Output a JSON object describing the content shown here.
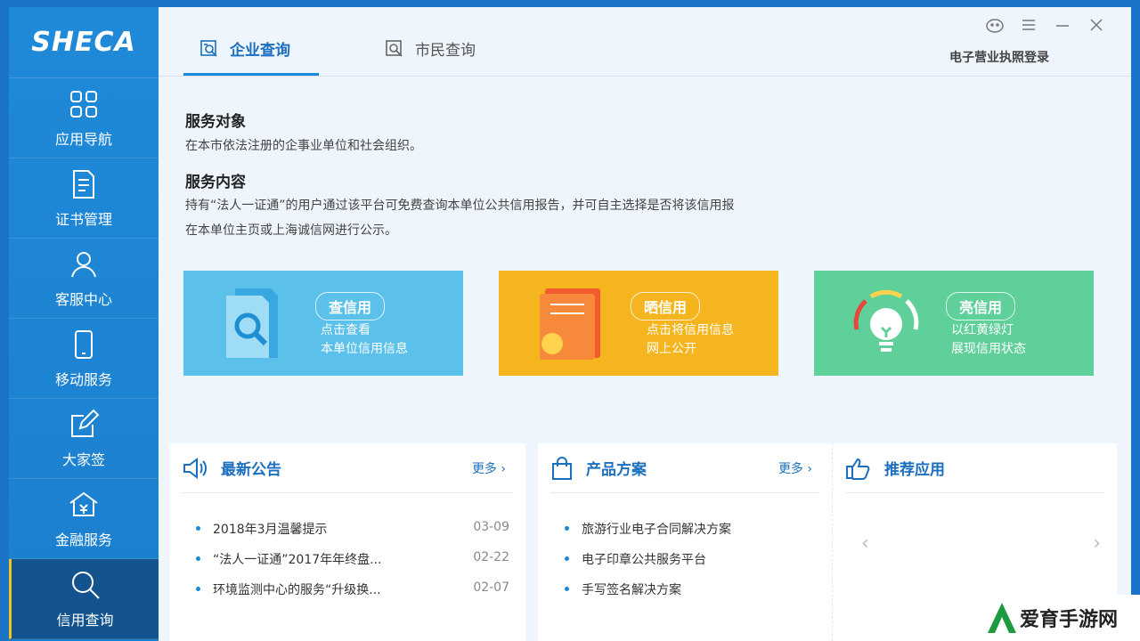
{
  "logo": {
    "text": "SHECA"
  },
  "sidebar": {
    "items": [
      {
        "label": "应用导航",
        "icon": "grid-icon"
      },
      {
        "label": "证书管理",
        "icon": "document-icon"
      },
      {
        "label": "客服中心",
        "icon": "user-icon"
      },
      {
        "label": "移动服务",
        "icon": "phone-icon"
      },
      {
        "label": "大家签",
        "icon": "edit-icon"
      },
      {
        "label": "金融服务",
        "icon": "bank-icon"
      },
      {
        "label": "信用查询",
        "icon": "search-icon",
        "active": true
      }
    ]
  },
  "tabs": [
    {
      "label": "企业查询",
      "active": true
    },
    {
      "label": "市民查询",
      "active": false
    }
  ],
  "header": {
    "biz_login": "电子营业执照登录"
  },
  "service": {
    "target_title": "服务对象",
    "target_text": "在本市依法注册的企事业单位和社会组织。",
    "content_title": "服务内容",
    "content_line1": "持有“法人一证通”的用户通过该平台可免费查询本单位公共信用报告，并可自主选择是否将该信用报",
    "content_line2": "在本单位主页或上海诚信网进行公示。"
  },
  "cards": [
    {
      "title": "查信用",
      "line1": "点击查看",
      "line2": "本单位信用信息",
      "color": "#5bc0ea"
    },
    {
      "title": "晒信用",
      "line1": "点击将信用信息",
      "line2": "网上公开",
      "color": "#f5b51f"
    },
    {
      "title": "亮信用",
      "line1": "以红黄绿灯",
      "line2": "展现信用状态",
      "color": "#5fd09a"
    }
  ],
  "announcements": {
    "title": "最新公告",
    "more": "更多",
    "items": [
      {
        "text": "2018年3月温馨提示",
        "date": "03-09"
      },
      {
        "text": "“法人一证通”2017年年终盘...",
        "date": "02-22"
      },
      {
        "text": "环境监测中心的服务“升级换...",
        "date": "02-07"
      }
    ]
  },
  "products": {
    "title": "产品方案",
    "more": "更多",
    "items": [
      {
        "text": "旅游行业电子合同解决方案"
      },
      {
        "text": "电子印章公共服务平台"
      },
      {
        "text": "手写签名解决方案"
      }
    ]
  },
  "recommend": {
    "title": "推荐应用"
  },
  "watermark": {
    "text": "爱育手游网"
  }
}
